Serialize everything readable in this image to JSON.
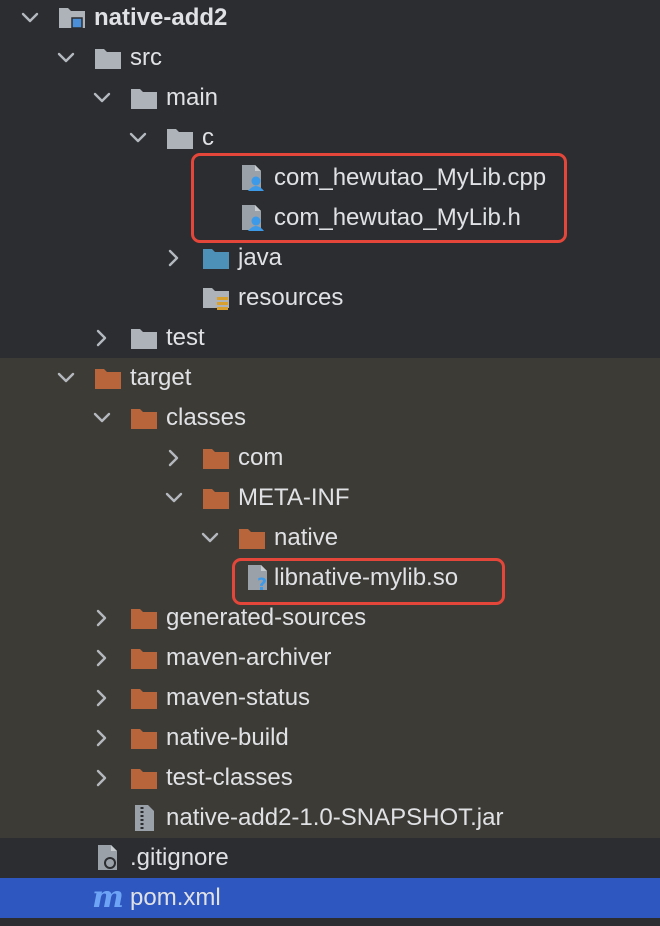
{
  "project_tree": {
    "rows": [
      {
        "label": "native-add2",
        "expanded": true,
        "icon": "module-folder-icon",
        "kind": "module",
        "bold": true
      },
      {
        "label": "src",
        "expanded": true,
        "icon": "folder-icon",
        "kind": "folder"
      },
      {
        "label": "main",
        "expanded": true,
        "icon": "folder-icon",
        "kind": "folder"
      },
      {
        "label": "c",
        "expanded": true,
        "icon": "folder-icon",
        "kind": "folder"
      },
      {
        "label": "com_hewutao_MyLib.cpp",
        "expanded": null,
        "icon": "cpp-file-icon",
        "kind": "cfile"
      },
      {
        "label": "com_hewutao_MyLib.h",
        "expanded": null,
        "icon": "header-file-icon",
        "kind": "cfile"
      },
      {
        "label": "java",
        "expanded": false,
        "icon": "source-folder-icon",
        "kind": "source"
      },
      {
        "label": "resources",
        "expanded": null,
        "icon": "resources-folder-icon",
        "kind": "resources"
      },
      {
        "label": "test",
        "expanded": false,
        "icon": "folder-icon",
        "kind": "folder"
      },
      {
        "label": "target",
        "expanded": true,
        "icon": "excluded-folder-icon",
        "kind": "excluded"
      },
      {
        "label": "classes",
        "expanded": true,
        "icon": "excluded-folder-icon",
        "kind": "excluded"
      },
      {
        "label": "com",
        "expanded": false,
        "icon": "excluded-folder-icon",
        "kind": "excluded"
      },
      {
        "label": "META-INF",
        "expanded": true,
        "icon": "excluded-folder-icon",
        "kind": "excluded"
      },
      {
        "label": "native",
        "expanded": true,
        "icon": "excluded-folder-icon",
        "kind": "excluded"
      },
      {
        "label": "libnative-mylib.so",
        "expanded": null,
        "icon": "unknown-file-icon",
        "kind": "unknown"
      },
      {
        "label": "generated-sources",
        "expanded": false,
        "icon": "excluded-folder-icon",
        "kind": "excluded"
      },
      {
        "label": "maven-archiver",
        "expanded": false,
        "icon": "excluded-folder-icon",
        "kind": "excluded"
      },
      {
        "label": "maven-status",
        "expanded": false,
        "icon": "excluded-folder-icon",
        "kind": "excluded"
      },
      {
        "label": "native-build",
        "expanded": false,
        "icon": "excluded-folder-icon",
        "kind": "excluded"
      },
      {
        "label": "test-classes",
        "expanded": false,
        "icon": "excluded-folder-icon",
        "kind": "excluded"
      },
      {
        "label": "native-add2-1.0-SNAPSHOT.jar",
        "expanded": null,
        "icon": "jar-file-icon",
        "kind": "jar"
      },
      {
        "label": ".gitignore",
        "expanded": null,
        "icon": "gitignore-file-icon",
        "kind": "gitignore"
      },
      {
        "label": "pom.xml",
        "expanded": null,
        "icon": "maven-pom-icon",
        "kind": "maven",
        "selected": true
      }
    ],
    "highlighted_items": [
      "com_hewutao_MyLib.cpp",
      "com_hewutao_MyLib.h",
      "libnative-mylib.so"
    ]
  },
  "colors": {
    "background": "#2b2d30",
    "excluded_background": "#3d3b35",
    "selection": "#2f57c0",
    "text": "#dfe1e5",
    "chevron": "#b4b8bf",
    "folder_gray": "#aeb3ba",
    "folder_excluded": "#b8653b",
    "source_folder": "#4d90b8",
    "highlight_border": "#e5463a",
    "person_blue": "#3d9ae8",
    "maven_blue": "#6ea4f6"
  }
}
